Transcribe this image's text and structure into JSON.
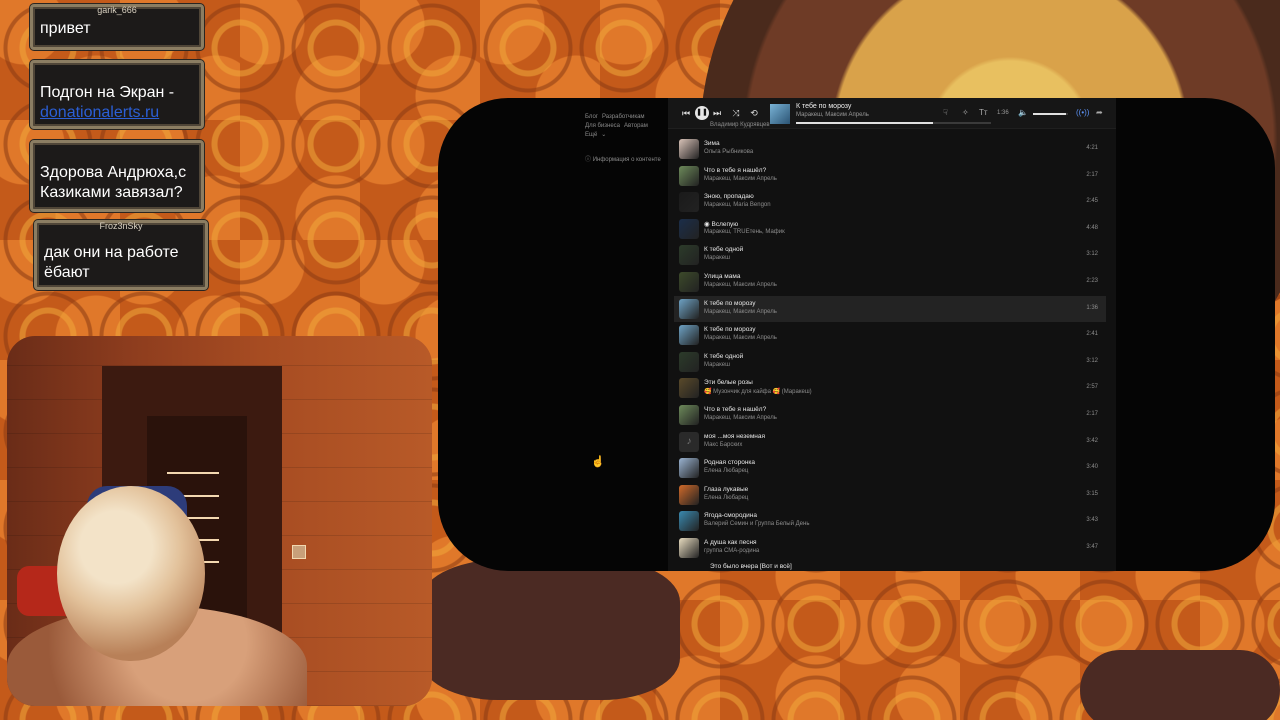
{
  "chat": [
    {
      "user": "garik_666",
      "text": "привет"
    },
    {
      "user": "",
      "text": "Подгон на Экран -",
      "link": "donationalerts.ru"
    },
    {
      "user": "",
      "text": "Здорова Андрюха,с Казиками завязал?"
    },
    {
      "user": "Froz3nSky",
      "text": "дак они на работе ёбают"
    }
  ],
  "sidebar": {
    "links": [
      "Блог",
      "Разработчикам",
      "Для бизнеса",
      "Авторам",
      "Ещё"
    ],
    "info": "Информация о контенте"
  },
  "player": {
    "title": "К тебе по морозу",
    "artist": "Маракеш, Максим Апрель",
    "time": "1:36",
    "progress": 0.7,
    "volume": 0.95
  },
  "partial_top": "Владимир Кудрявцев",
  "tracks": [
    {
      "title": "Зима",
      "artist": "Ольга Рыбникова",
      "duration": "4:21",
      "color": "#d9c3b8"
    },
    {
      "title": "Что в тебе я нашёл?",
      "artist": "Маракеш, Максим Апрель",
      "duration": "2:17",
      "color": "#6d8a5a"
    },
    {
      "title": "Зною, пропадаю",
      "artist": "Маракеш, Maria Bengon",
      "duration": "2:45",
      "color": "#1a1a1a"
    },
    {
      "title": "◉ Вслепую",
      "artist": "Маракеш, TRUEтень, Мафик",
      "duration": "4:48",
      "color": "#1b2e4a"
    },
    {
      "title": "К тебе одной",
      "artist": "Маракеш",
      "duration": "3:12",
      "color": "#2c3b2a"
    },
    {
      "title": "Улица мама",
      "artist": "Маракеш, Максим Апрель",
      "duration": "2:23",
      "color": "#3c4a2a"
    },
    {
      "title": "К тебе по морозу",
      "artist": "Маракеш, Максим Апрель",
      "duration": "1:36",
      "color": "#6ea2c4",
      "active": true
    },
    {
      "title": "К тебе по морозу",
      "artist": "Маракеш, Максим Апрель",
      "duration": "2:41",
      "color": "#6ea2c4"
    },
    {
      "title": "К тебе одной",
      "artist": "Маракеш",
      "duration": "3:12",
      "color": "#2c3b2a"
    },
    {
      "title": "Эти белые розы",
      "artist": "🥰 Музончик для кайфа 🥰 (Маракеш)",
      "duration": "2:57",
      "color": "#5a4a2a"
    },
    {
      "title": "Что в тебе я нашёл?",
      "artist": "Маракеш, Максим Апрель",
      "duration": "2:17",
      "color": "#6d8a5a"
    },
    {
      "title": "моя ...моя неземная",
      "artist": "Макс Барских",
      "duration": "3:42",
      "color": "note"
    },
    {
      "title": "Родная сторонка",
      "artist": "Елена Любарец",
      "duration": "3:40",
      "color": "#9ab3d1"
    },
    {
      "title": "Глаза лукавые",
      "artist": "Елена Любарец",
      "duration": "3:15",
      "color": "#d06a2a"
    },
    {
      "title": "Ягода-смородина",
      "artist": "Валерий Семин и Группа Белый День",
      "duration": "3:43",
      "color": "#3a8ab0"
    },
    {
      "title": "А душа как песня",
      "artist": "группа СМА-родина",
      "duration": "3:47",
      "color": "#e8dcc0"
    }
  ],
  "partial_bottom": "Это было вчера [Вот и всё]"
}
